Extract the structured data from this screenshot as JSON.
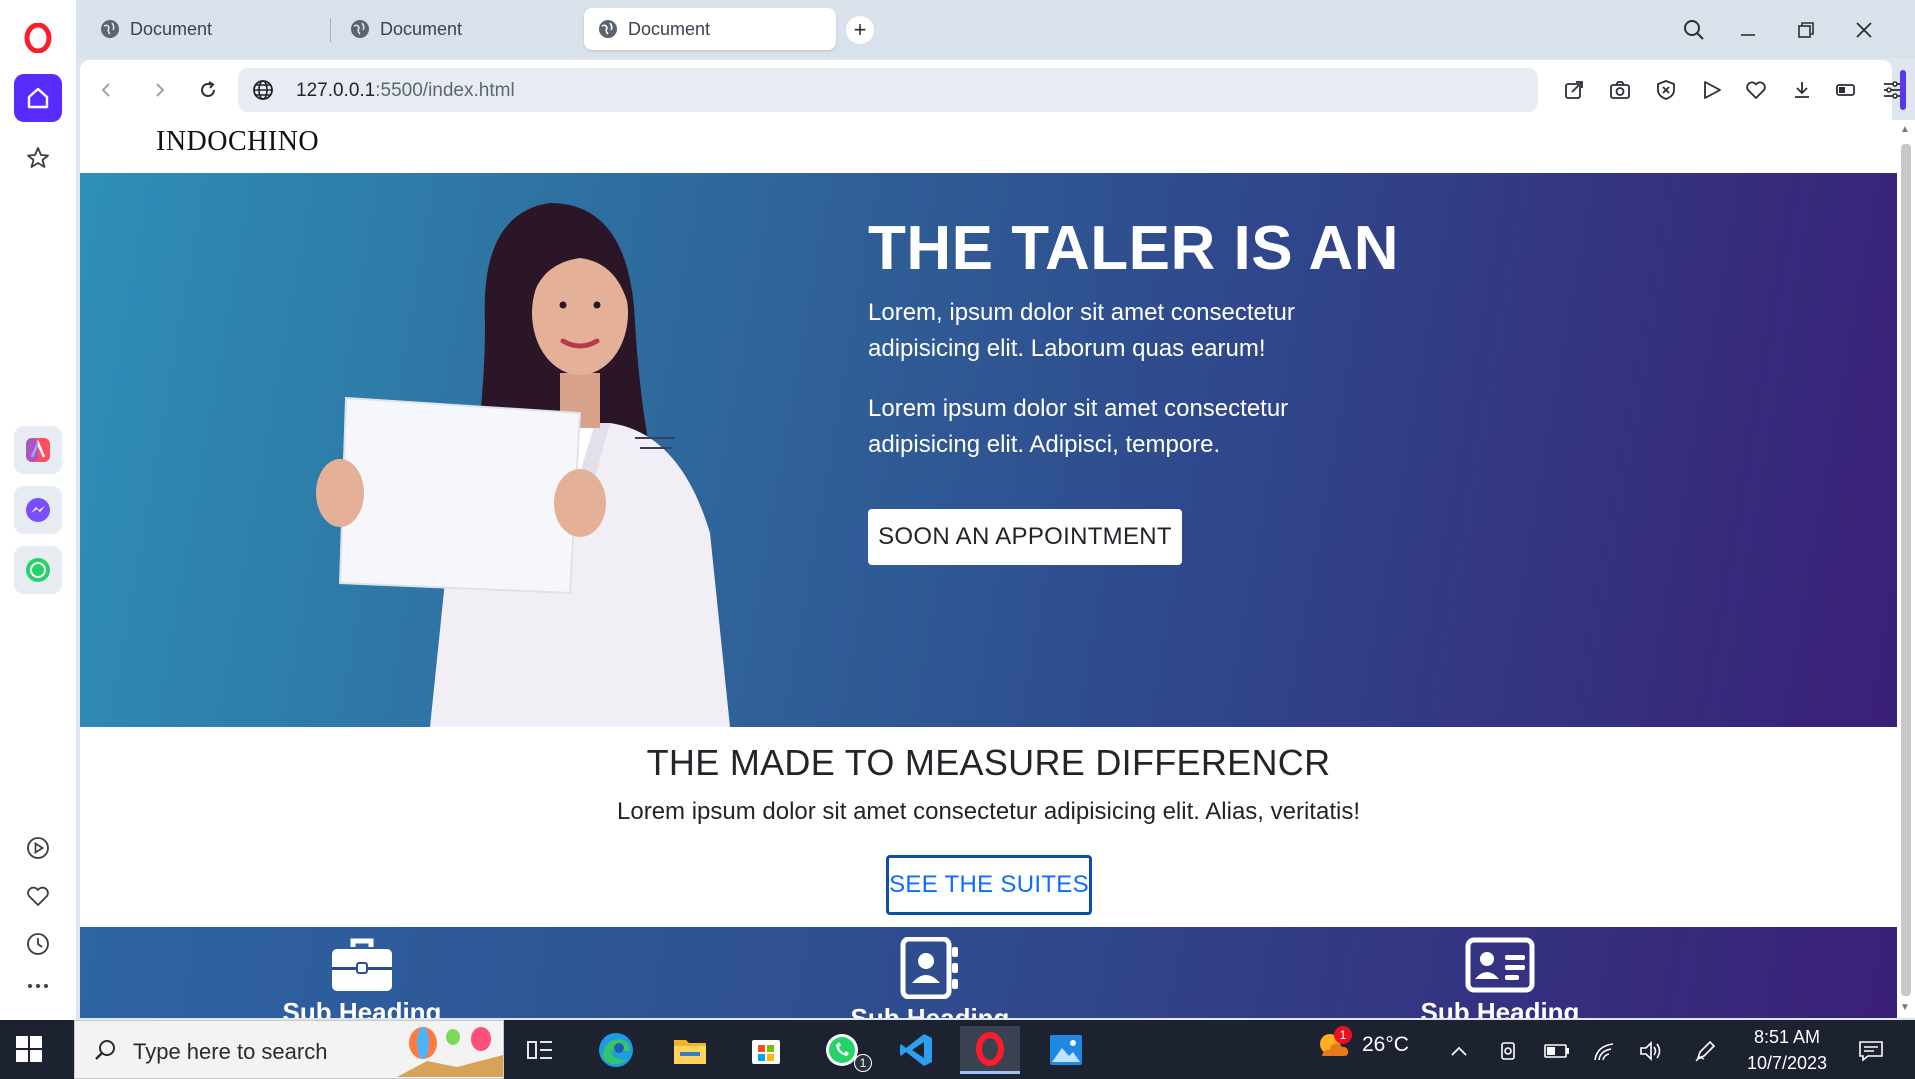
{
  "browser": {
    "tabs": [
      {
        "label": "Document"
      },
      {
        "label": "Document"
      },
      {
        "label": "Document"
      }
    ],
    "new_tab_label": "+",
    "url": {
      "host": "127.0.0.1",
      "rest": ":5500/index.html"
    }
  },
  "page": {
    "brand": "INDOCHINO",
    "hero": {
      "title": "THE TALER IS AN",
      "paragraph1": "Lorem, ipsum dolor sit amet consectetur adipisicing elit. Laborum quas earum!",
      "paragraph2": "Lorem ipsum dolor sit amet consectetur adipisicing elit. Adipisci, tempore.",
      "button": "SOON AN APPOINTMENT"
    },
    "section": {
      "title": "THE MADE TO MEASURE DIFFERENCR",
      "text": "Lorem ipsum dolor sit amet consectetur adipisicing elit. Alias, veritatis!",
      "button": "SEE THE SUITES"
    },
    "features": [
      {
        "icon": "briefcase-icon",
        "label": "Sub Heading"
      },
      {
        "icon": "address-book-icon",
        "label": "Sub Heading"
      },
      {
        "icon": "id-card-icon",
        "label": "Sub Heading"
      }
    ],
    "colors": {
      "hero_start": "#2e8fb7",
      "hero_end": "#3a1f78",
      "suites_button": "#0d6efd"
    }
  },
  "taskbar": {
    "search_placeholder": "Type here to search",
    "weather": "26°C",
    "weather_badge": "1",
    "whatsapp_badge": "1",
    "time": "8:51 AM",
    "date": "10/7/2023"
  }
}
